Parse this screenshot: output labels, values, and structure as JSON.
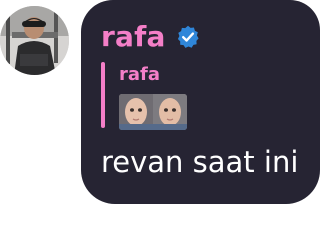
{
  "message": {
    "sender_name": "rafa",
    "verified": true,
    "verified_icon": "verified-badge-icon",
    "reply": {
      "sender_name": "rafa",
      "attachment": "baby-photo-thumbnail"
    },
    "text": "revan saat ini"
  },
  "colors": {
    "bubble_background": "#262433",
    "sender_name": "#f47fc8",
    "reply_bar": "#f47fc8",
    "message_text": "#ffffff",
    "verified_badge": "#2f86d9"
  }
}
